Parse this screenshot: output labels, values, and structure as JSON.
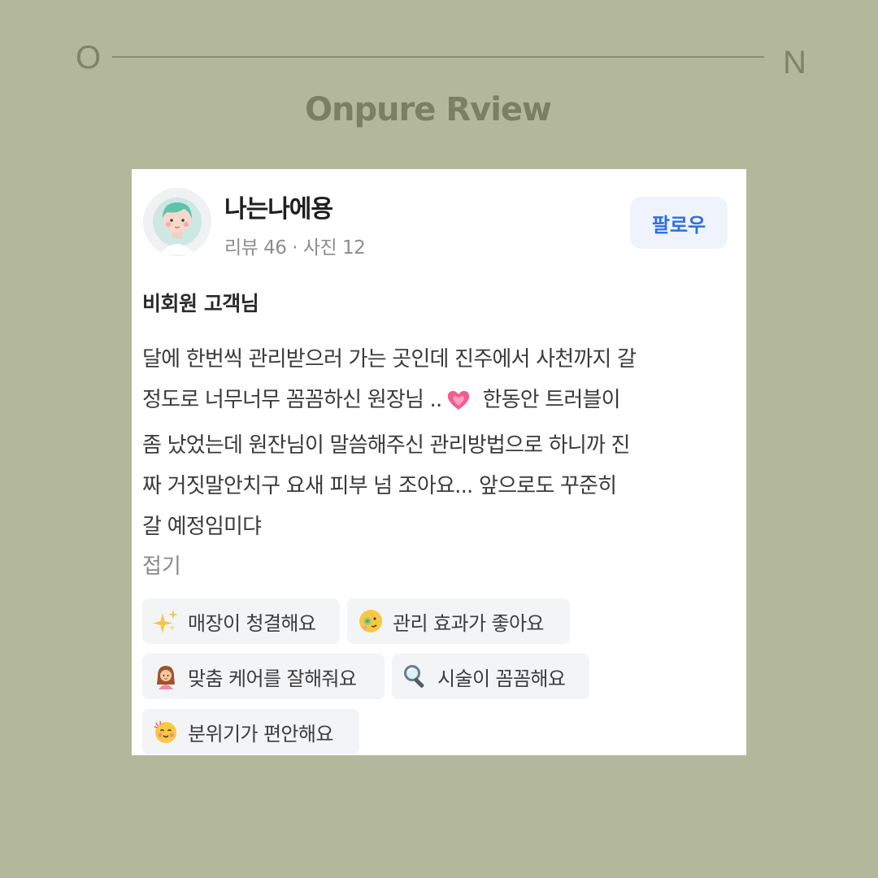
{
  "decor": {
    "left_letter": "O",
    "right_letter": "N"
  },
  "brand": {
    "title": "Onpure Rview"
  },
  "profile": {
    "name": "나는나에용",
    "meta": "리뷰 46 · 사진 12",
    "follow_label": "팔로우"
  },
  "review": {
    "reviewer": "비회원 고객님",
    "lines": [
      "달에 한번씩 관리받으러 가는 곳인데 진주에서 사천까지 갈",
      "정도로 너무너무 꼼꼼하신 원장님 ..",
      "한동안 트러블이",
      "좀 났었는데 원잔님이 말씀해주신 관리방법으로 하니까 진",
      "짜 거짓말안치구 요새 피부 넘 조아요... 앞으로도 꾸준히",
      "갈 예정임미댜"
    ],
    "collapse_label": "접기"
  },
  "tags": [
    {
      "label": "매장이 청결해요",
      "icon": "sparkles-icon"
    },
    {
      "label": "관리 효과가 좋아요",
      "icon": "face-mask-icon"
    },
    {
      "label": "맞춤 케어를 잘해줘요",
      "icon": "person-icon"
    },
    {
      "label": "시술이 꼼꼼해요",
      "icon": "magnifier-icon"
    },
    {
      "label": "분위기가 편안해요",
      "icon": "smiling-face-icon"
    }
  ],
  "colors": {
    "background": "#b4b89a",
    "brand_text": "#7b8062",
    "follow_text": "#2e6fe0",
    "follow_bg": "#eef3fc",
    "tag_bg": "#f3f4f6"
  }
}
